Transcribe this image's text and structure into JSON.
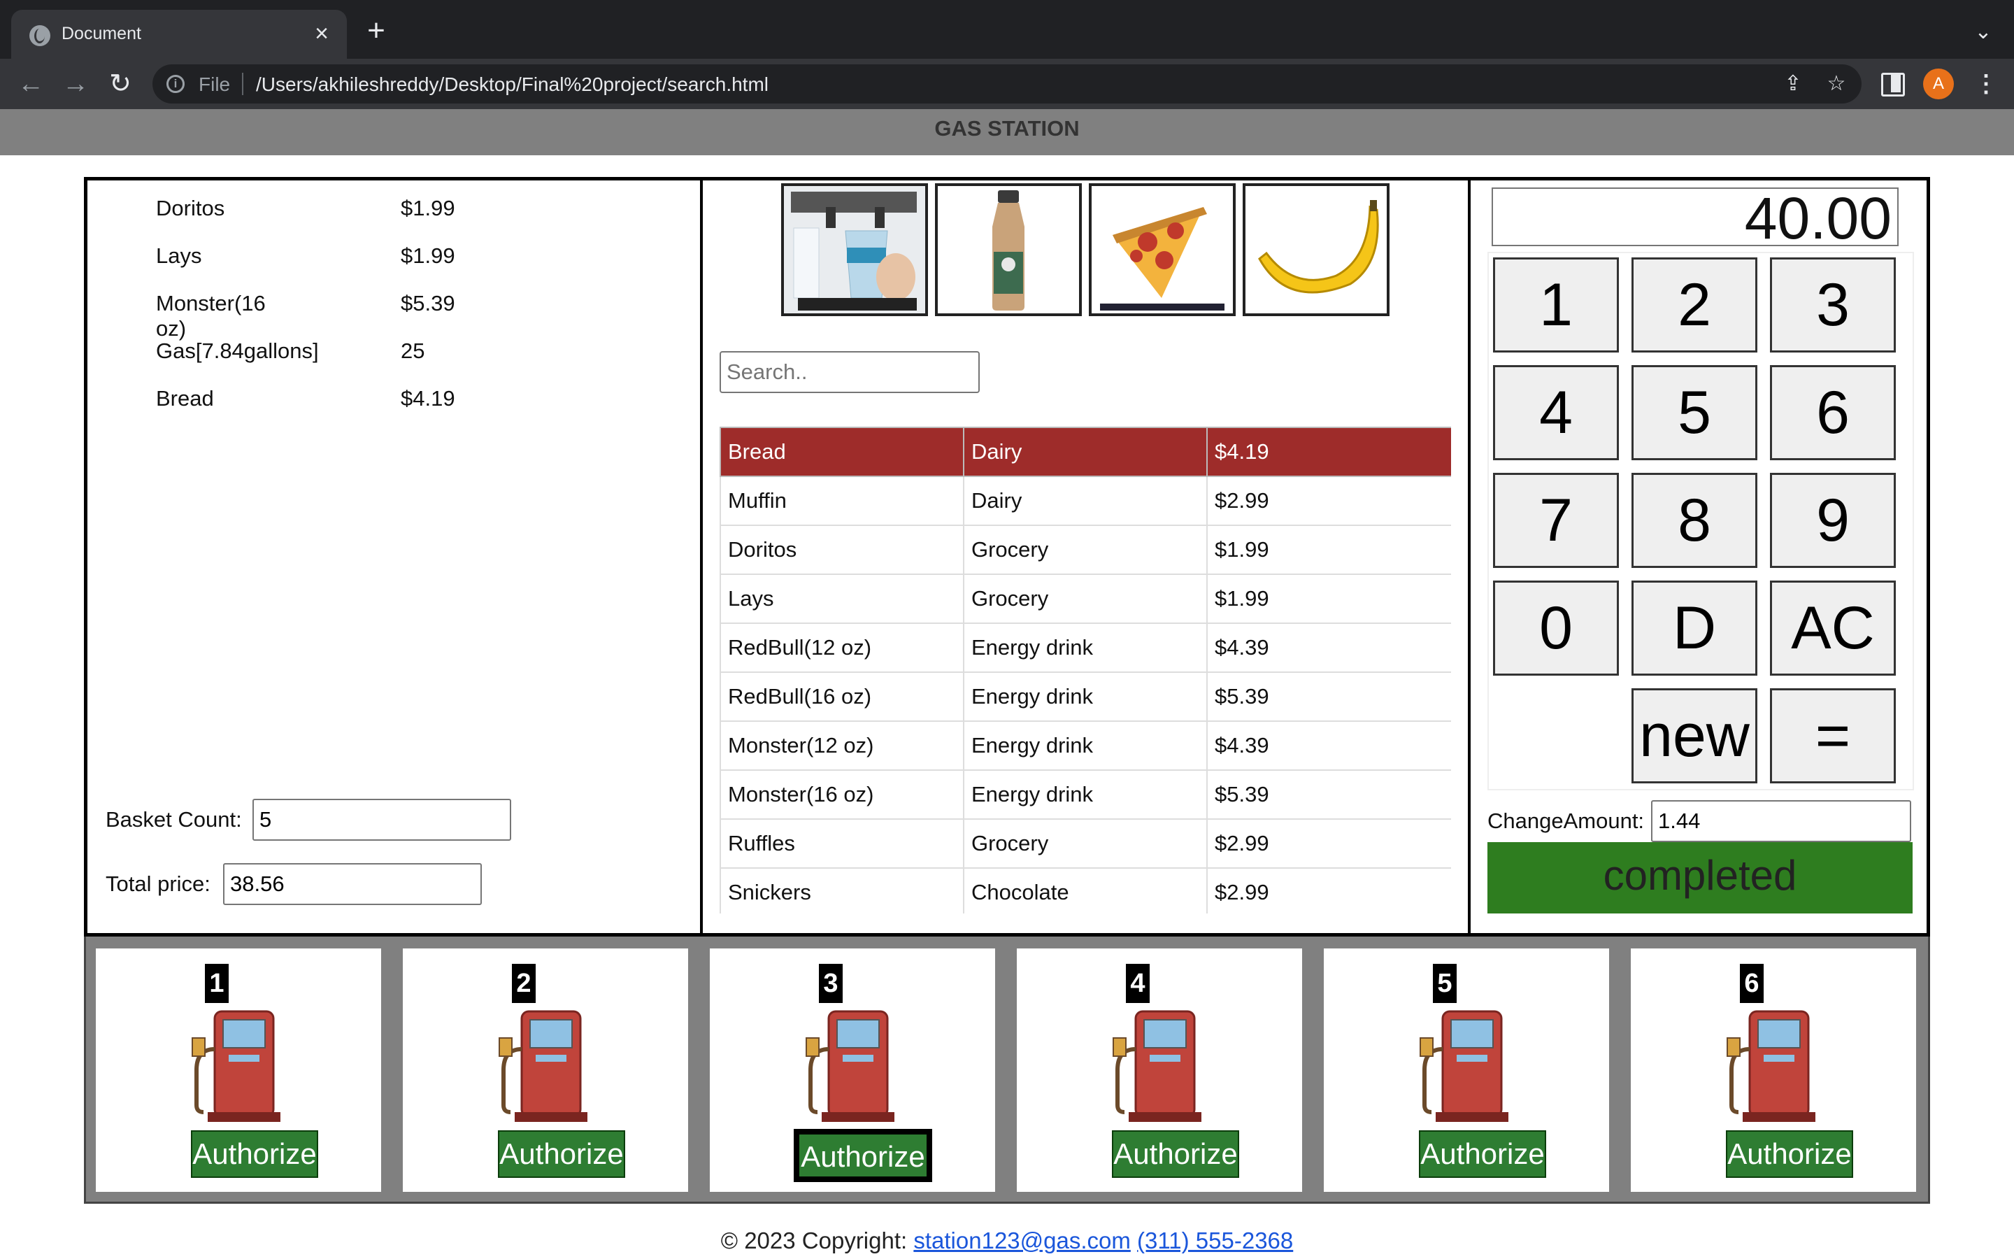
{
  "browser": {
    "tab_title": "Document",
    "scheme": "File",
    "url": "/Users/akhileshreddy/Desktop/Final%20project/search.html",
    "profile_initial": "A"
  },
  "site": {
    "title": "GAS STATION"
  },
  "basket": {
    "items": [
      {
        "name": "Doritos",
        "price": "$1.99"
      },
      {
        "name": "Lays",
        "price": "$1.99"
      },
      {
        "name": "Monster(16 oz)",
        "price": "$5.39"
      },
      {
        "name": "Gas[7.84gallons]",
        "price": "25"
      },
      {
        "name": "Bread",
        "price": "$4.19"
      }
    ],
    "count_label": "Basket Count:",
    "count_value": "5",
    "total_label": "Total price:",
    "total_value": "38.56"
  },
  "products": {
    "tiles": [
      {
        "name": "fountain-drink"
      },
      {
        "name": "frappuccino-bottle"
      },
      {
        "name": "pizza-slice"
      },
      {
        "name": "banana"
      }
    ],
    "search_placeholder": "Search..",
    "rows": [
      [
        "Bread",
        "Dairy",
        "$4.19"
      ],
      [
        "Muffin",
        "Dairy",
        "$2.99"
      ],
      [
        "Doritos",
        "Grocery",
        "$1.99"
      ],
      [
        "Lays",
        "Grocery",
        "$1.99"
      ],
      [
        "RedBull(12 oz)",
        "Energy drink",
        "$4.39"
      ],
      [
        "RedBull(16 oz)",
        "Energy drink",
        "$5.39"
      ],
      [
        "Monster(12 oz)",
        "Energy drink",
        "$4.39"
      ],
      [
        "Monster(16 oz)",
        "Energy drink",
        "$5.39"
      ],
      [
        "Ruffles",
        "Grocery",
        "$2.99"
      ],
      [
        "Snickers",
        "Chocolate",
        "$2.99"
      ]
    ],
    "highlight_color": "#9e2c2a"
  },
  "calculator": {
    "display": "40.00",
    "keys": [
      "1",
      "2",
      "3",
      "4",
      "5",
      "6",
      "7",
      "8",
      "9",
      "0",
      "D",
      "AC",
      "new",
      "="
    ],
    "change_label": "ChangeAmount:",
    "change_value": "1.44",
    "complete_label": "completed",
    "complete_color": "#2e7d1f"
  },
  "pumps": [
    {
      "number": "1",
      "button": "Authorize"
    },
    {
      "number": "2",
      "button": "Authorize"
    },
    {
      "number": "3",
      "button": "Authorize"
    },
    {
      "number": "4",
      "button": "Authorize"
    },
    {
      "number": "5",
      "button": "Authorize"
    },
    {
      "number": "6",
      "button": "Authorize"
    }
  ],
  "footer": {
    "copyright": "© 2023 Copyright:",
    "email": "station123@gas.com",
    "phone": "(311) 555-2368"
  }
}
